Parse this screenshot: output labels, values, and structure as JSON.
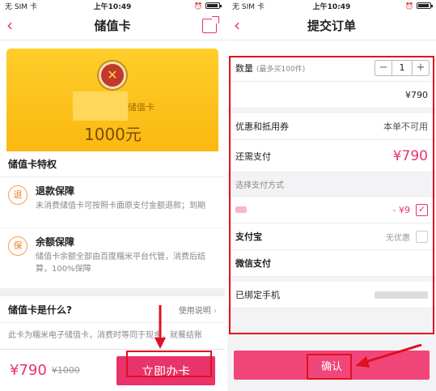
{
  "left": {
    "status": {
      "carrier": "无 SIM 卡",
      "time": "上午10:49"
    },
    "nav": {
      "title": "储值卡"
    },
    "card": {
      "label": "储值卡",
      "value": "1000元"
    },
    "features_title": "储值卡特权",
    "features": [
      {
        "icon": "退",
        "title": "退款保障",
        "desc": "未消费储值卡可按照卡面原支付金额退款；到期"
      },
      {
        "icon": "保",
        "title": "余额保障",
        "desc": "储值卡余额全部由百度糯米平台代管，消费后结算，100%保障"
      }
    ],
    "what": {
      "title": "储值卡是什么?",
      "guide": "使用说明",
      "desc": "此卡为糯米电子储值卡，消费时等同于现金，就餐结账"
    },
    "bottom": {
      "price": "¥790",
      "orig": "¥1000",
      "buy": "立即办卡"
    }
  },
  "right": {
    "status": {
      "carrier": "无 SIM 卡",
      "time": "上午10:49"
    },
    "nav": {
      "title": "提交订单"
    },
    "qty": {
      "label": "数量",
      "note": "(最多买100件)",
      "minus": "−",
      "value": "1",
      "plus": "+"
    },
    "subtotal": {
      "value": "¥790"
    },
    "coupon": {
      "label": "优惠和抵用券",
      "value": "本单不可用"
    },
    "need_pay": {
      "label": "还需支付",
      "value": "¥790"
    },
    "pay_method": {
      "label": "选择支付方式"
    },
    "balance": {
      "value": "- ¥9",
      "check": "✓"
    },
    "alipay": {
      "label": "支付宝",
      "note": "无优惠"
    },
    "wechat": {
      "label": "微信支付"
    },
    "phone": {
      "label": "已绑定手机"
    },
    "confirm": "确认"
  },
  "colors": {
    "accent": "#e8336b",
    "card": "#fbb811",
    "highlight": "#e01020"
  }
}
